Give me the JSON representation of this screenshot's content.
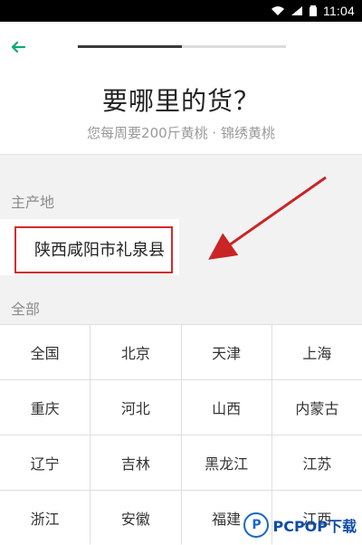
{
  "statusbar": {
    "time": "11:04",
    "icons": [
      "wifi-icon",
      "signal-icon",
      "battery-icon"
    ]
  },
  "header": {
    "progress_fraction": 0.5,
    "title": "要哪里的货？",
    "subtitle": "您每周要200斤黄桃 · 锦绣黄桃"
  },
  "origin": {
    "label": "主产地",
    "region": "陕西咸阳市礼泉县"
  },
  "all": {
    "label": "全部",
    "regions": [
      "全国",
      "北京",
      "天津",
      "上海",
      "重庆",
      "河北",
      "山西",
      "内蒙古",
      "辽宁",
      "吉林",
      "黑龙江",
      "江苏",
      "浙江",
      "安徽",
      "福建",
      "江西"
    ]
  },
  "watermark": {
    "text": "PCPOP下载"
  },
  "colors": {
    "accent": "#12a57a",
    "highlight": "#d42b2b",
    "watermark": "#1a67c6"
  }
}
